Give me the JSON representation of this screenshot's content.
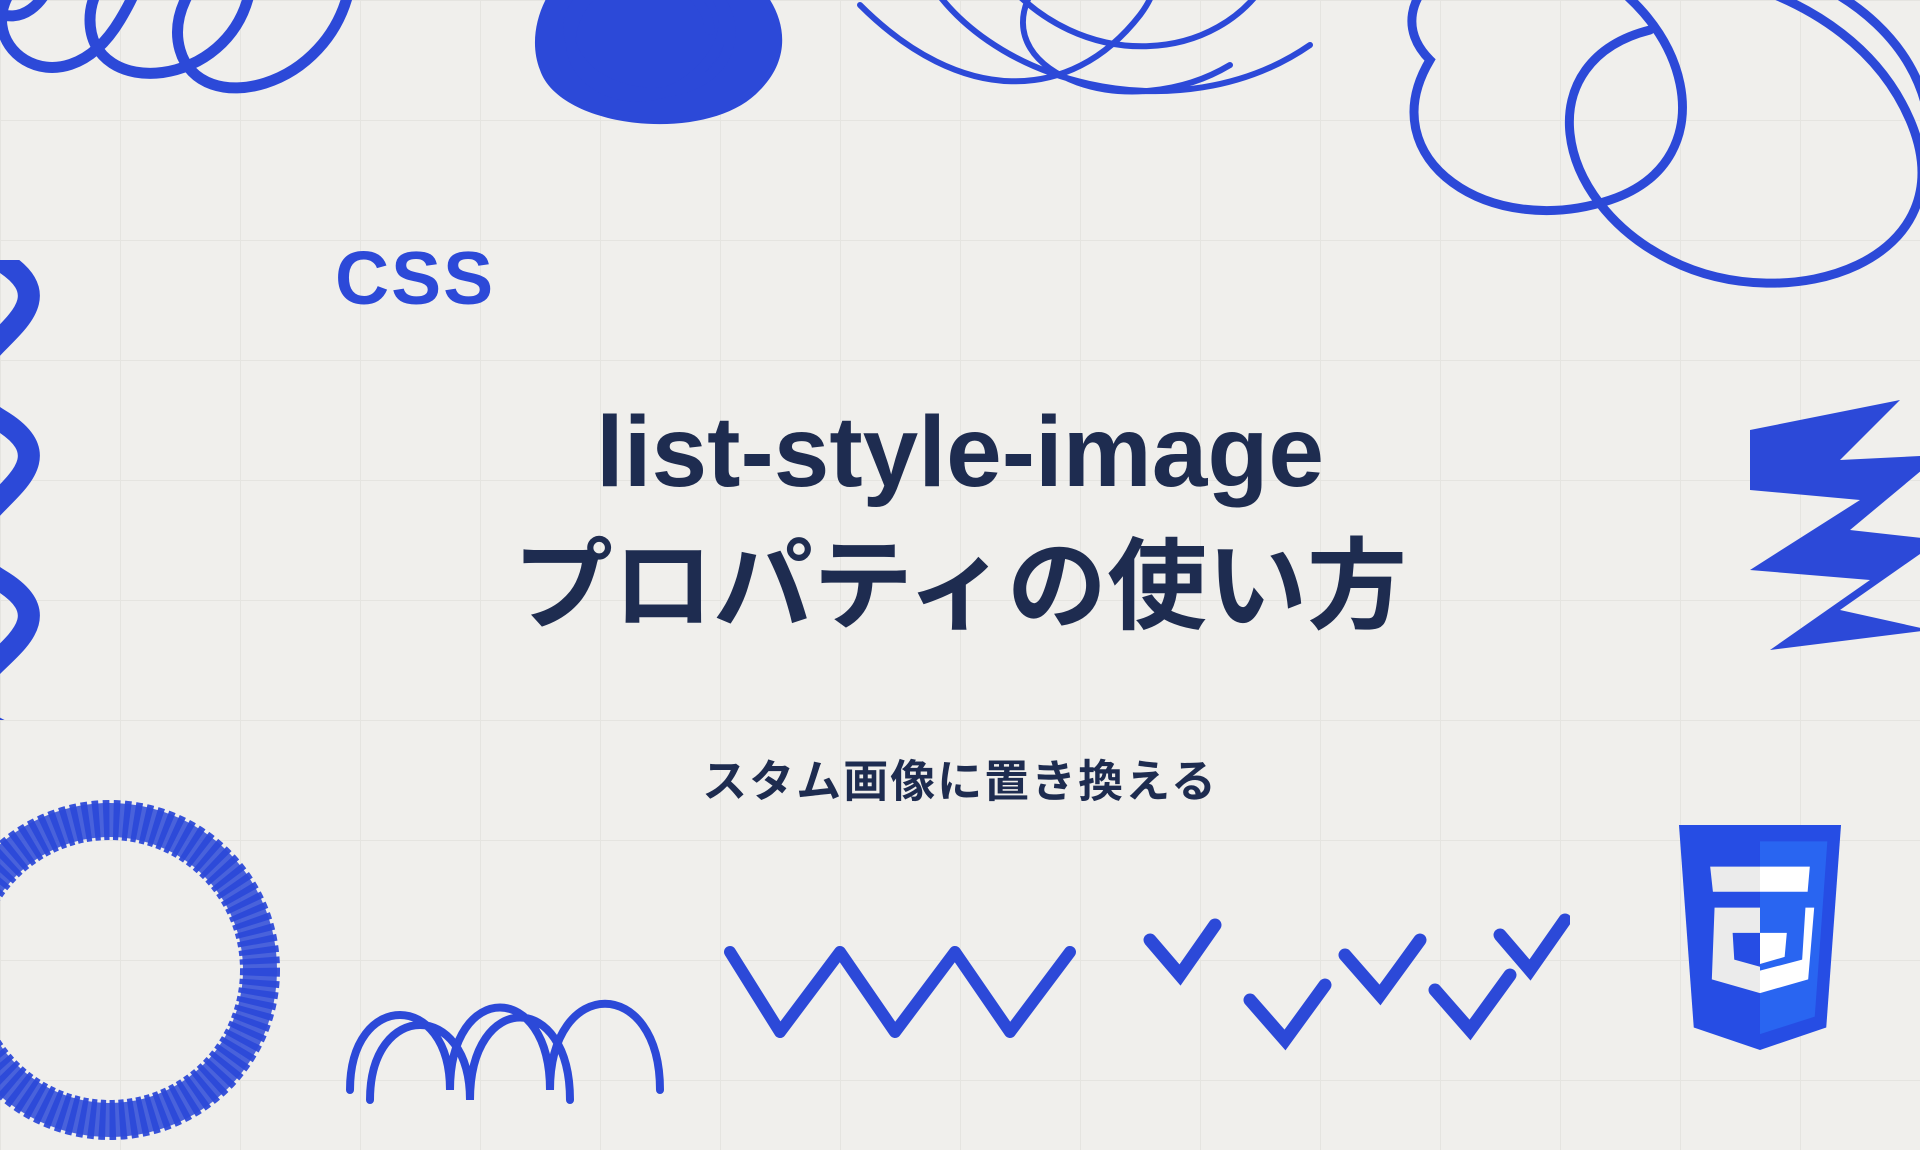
{
  "category": "CSS",
  "title_line1": "list-style-image",
  "title_line2": "プロパティの使い方",
  "subtitle": "スタム画像に置き換える",
  "logo_text": "3",
  "colors": {
    "accent": "#2c49d8",
    "text": "#1e2c50",
    "bg": "#f0efec"
  }
}
